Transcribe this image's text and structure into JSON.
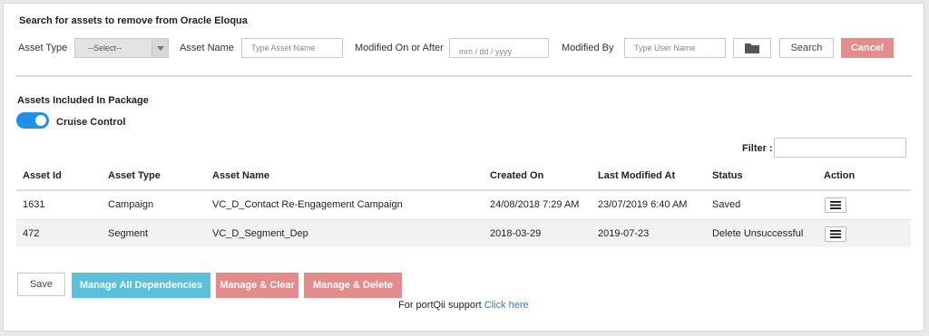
{
  "search": {
    "title": "Search for assets to remove from Oracle Eloqua",
    "asset_type_label": "Asset Type",
    "asset_type_value": "--Select--",
    "asset_name_label": "Asset Name",
    "asset_name_placeholder": "Type Asset Name",
    "modified_label": "Modified On or After",
    "modified_placeholder": "mm / dd / yyyy",
    "modified_by_label": "Modified By",
    "modified_by_placeholder": "Type User Name",
    "search_label": "Search",
    "cancel_label": "Cancel"
  },
  "package": {
    "title": "Assets Included In Package",
    "cruise_label": "Cruise Control",
    "cruise_on": true,
    "filter_label": "Filter :"
  },
  "table": {
    "headers": [
      "Asset Id",
      "Asset Type",
      "Asset Name",
      "Created On",
      "Last Modified At",
      "Status",
      "Action"
    ],
    "rows": [
      {
        "id": "1631",
        "type": "Campaign",
        "name": "VC_D_Contact Re-Engagement Campaign",
        "created": "24/08/2018 7:29 AM",
        "modified": "23/07/2019 6:40 AM",
        "status": "Saved"
      },
      {
        "id": "472",
        "type": "Segment",
        "name": "VC_D_Segment_Dep",
        "created": "2018-03-29",
        "modified": "2019-07-23",
        "status": "Delete Unsuccessful"
      }
    ]
  },
  "footer": {
    "save_label": "Save",
    "manage_all_label": "Manage All Dependencies",
    "manage_clear_label": "Manage & Clear",
    "manage_delete_label": "Manage & Delete",
    "support_text": "For portQii support",
    "support_link": "Click here"
  },
  "colors": {
    "accent_blue": "#1e90e8",
    "button_red": "#e58b8b",
    "button_cyan": "#5bc0de",
    "link": "#2a7bd4"
  }
}
